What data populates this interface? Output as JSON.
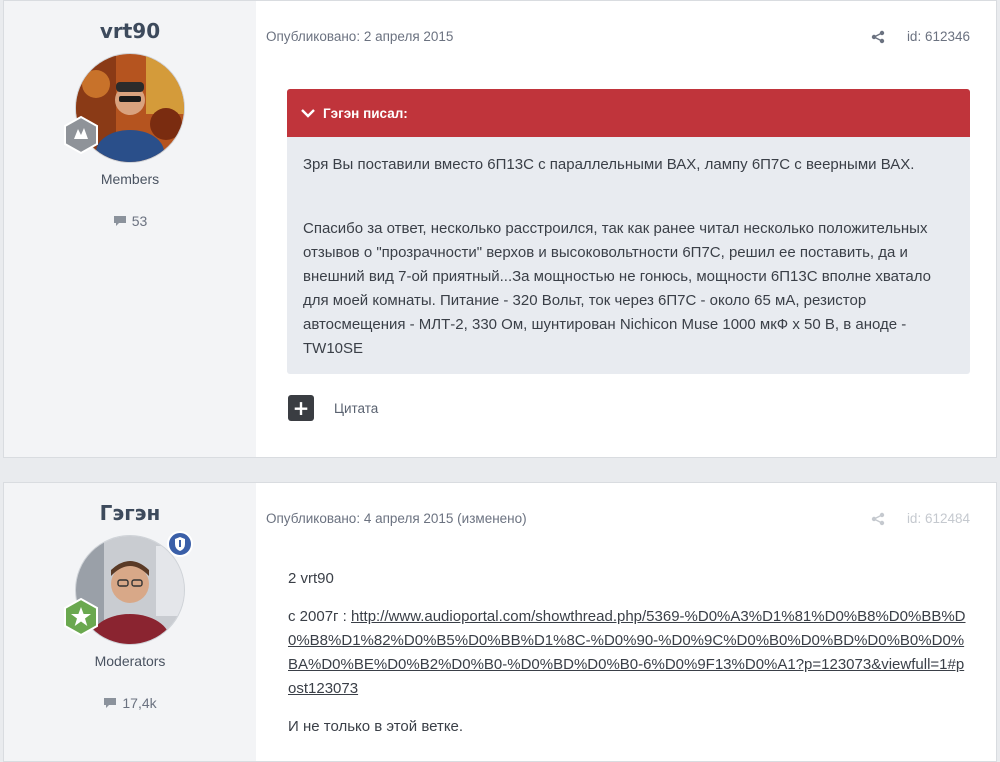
{
  "posts": [
    {
      "author": "vrt90",
      "group": "Members",
      "post_count": "53",
      "published": "Опубликовано: 2 апреля 2015",
      "post_id": "id: 612346",
      "quote_author": "Гэгэн писал:",
      "quote_text": "Зря Вы поставили вместо 6П13С с параллельными ВАХ, лампу 6П7С с веерными ВАХ.",
      "body": "Спасибо за ответ, несколько расстроился, так как ранее читал несколько положительных отзывов о \"прозрачности\" верхов и высоковольтности 6П7С, решил ее поставить, да и внешний вид 7-ой приятный...За мощностью не гонюсь, мощности 6П13С вполне хватало для моей комнаты. Питание - 320 Вольт, ток через 6П7С - около 65 мА, резистор автосмещения - МЛТ-2, 330 Ом, шунтирован Nichicon Muse 1000 мкФ х 50 В, в аноде - TW10SE",
      "quote_button": "Цитата"
    },
    {
      "author": "Гэгэн",
      "group": "Moderators",
      "post_count": "17,4k",
      "published": "Опубликовано: 4 апреля 2015 (изменено)",
      "post_id": "id: 612484",
      "greeting": "2 vrt90",
      "link_prefix": "с 2007г : ",
      "link_url": "http://www.audioportal.com/showthread.php/5369-%D0%A3%D1%81%D0%B8%D0%BB%D0%B8%D1%82%D0%B5%D0%BB%D1%8C-%D0%90-%D0%9C%D0%B0%D0%BD%D0%B0%D0%BA%D0%BE%D0%B2%D0%B0-%D0%BD%D0%B0-6%D0%9F13%D0%A1?p=123073&viewfull=1#post123073",
      "closing": "И не только в этой ветке."
    }
  ],
  "colors": {
    "quote_header": "#c0343b",
    "quote_bg": "#e8ebf0",
    "sidebar_bg": "#f3f4f6"
  },
  "icons": [
    "share-icon",
    "comment-icon",
    "chevron-down-icon",
    "plus-icon",
    "rank-badge-icon",
    "moderator-shield-icon"
  ]
}
